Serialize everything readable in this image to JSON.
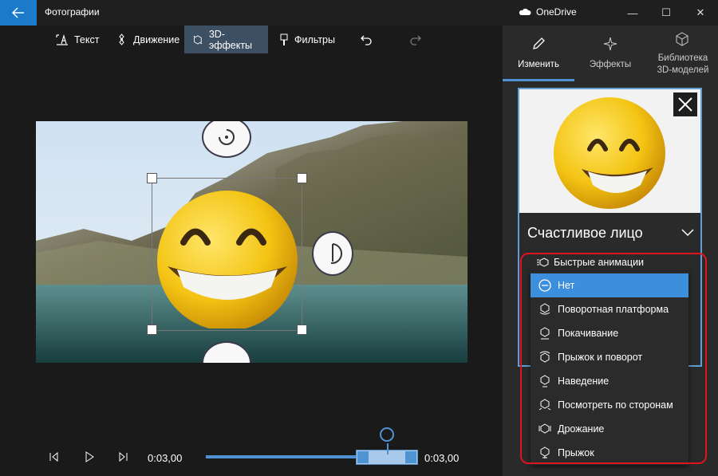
{
  "app": {
    "title": "Фотографии",
    "cloud_label": "OneDrive"
  },
  "window_controls": {
    "minimize": "—",
    "maximize": "☐",
    "close": "✕"
  },
  "toolbar": {
    "text_label": "Текст",
    "motion_label": "Движение",
    "effects3d_label": "3D-эффекты",
    "filters_label": "Фильтры"
  },
  "panel": {
    "tabs": [
      {
        "label": "Изменить",
        "icon": "pencil-icon",
        "active": true
      },
      {
        "label": "Эффекты",
        "icon": "sparkle-icon",
        "active": false
      },
      {
        "label": "Библиотека 3D-моделей",
        "icon": "cube-icon",
        "active": false
      }
    ],
    "model_name": "Счастливое лицо",
    "quick_animations_label": "Быстрые анимации",
    "animations": [
      {
        "label": "Нет",
        "selected": true,
        "icon": "none-icon"
      },
      {
        "label": "Поворотная платформа",
        "selected": false,
        "icon": "turntable-icon"
      },
      {
        "label": "Покачивание",
        "selected": false,
        "icon": "sway-icon"
      },
      {
        "label": "Прыжок и поворот",
        "selected": false,
        "icon": "jump-turn-icon"
      },
      {
        "label": "Наведение",
        "selected": false,
        "icon": "hover-icon"
      },
      {
        "label": "Посмотреть по сторонам",
        "selected": false,
        "icon": "look-around-icon"
      },
      {
        "label": "Дрожание",
        "selected": false,
        "icon": "shake-icon"
      },
      {
        "label": "Прыжок",
        "selected": false,
        "icon": "jump-icon"
      }
    ]
  },
  "timeline": {
    "current_time": "0:03,00",
    "end_time": "0:03,00",
    "progress": 0.72
  },
  "colors": {
    "accent": "#4f93d3",
    "selected": "#3c8fdd",
    "highlight_outline": "#e0141e"
  }
}
